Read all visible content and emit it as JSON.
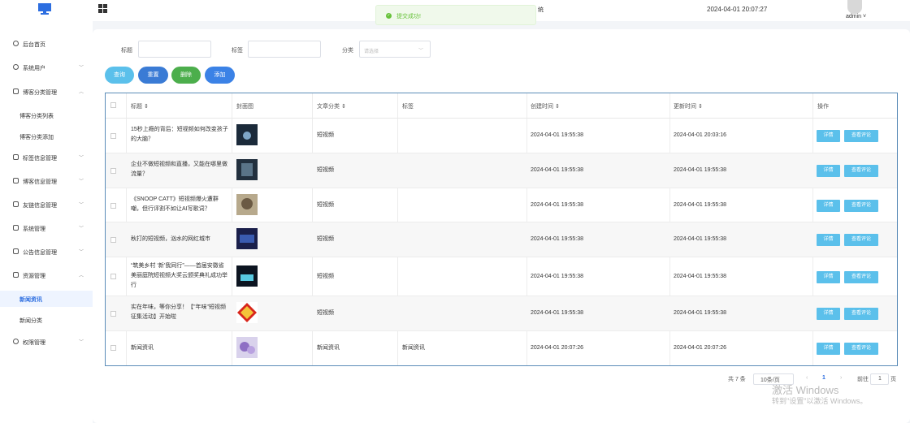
{
  "topbar": {
    "title_fragment": "统",
    "datetime": "2024-04-01 20:07:27",
    "user": "admin ˅"
  },
  "toast": {
    "message": "提交成功!"
  },
  "sidebar": {
    "items": [
      {
        "label": "后台首页",
        "icon": "dashboard-icon"
      },
      {
        "label": "系统用户",
        "icon": "user-icon"
      },
      {
        "label": "博客分类管理",
        "icon": "folder-icon"
      },
      {
        "label": "博客分类列表",
        "icon": ""
      },
      {
        "label": "博客分类添加",
        "icon": ""
      },
      {
        "label": "标签信息管理",
        "icon": "tag-icon"
      },
      {
        "label": "博客信息管理",
        "icon": "doc-icon"
      },
      {
        "label": "友链信息管理",
        "icon": "link-icon"
      },
      {
        "label": "系统管理",
        "icon": "settings-icon"
      },
      {
        "label": "公告信息管理",
        "icon": "notice-icon"
      },
      {
        "label": "资源管理",
        "icon": "resource-icon"
      },
      {
        "label": "新闻资讯",
        "icon": ""
      },
      {
        "label": "新闻分类",
        "icon": ""
      },
      {
        "label": "权限管理",
        "icon": "user-icon"
      }
    ]
  },
  "filters": {
    "title_label": "标题",
    "tag_label": "标签",
    "category_label": "分类",
    "category_placeholder": "请选择"
  },
  "buttons": {
    "search": "查询",
    "reset": "重置",
    "delete": "删除",
    "add": "添加"
  },
  "colors": {
    "search": "#5bc0eb",
    "reset": "#3a7bd5",
    "delete": "#4cae4c",
    "add": "#3b82e6",
    "action": "#5bc0eb"
  },
  "table": {
    "headers": [
      "标题 ⇕",
      "封面图",
      "文章分类 ⇕",
      "标签",
      "创建时间 ⇕",
      "更新时间 ⇕",
      "操作"
    ],
    "rows": [
      {
        "title": "15秒上瘾的背后：短视频如何改变孩子的大脑？",
        "category": "短视频",
        "tag": "",
        "created": "2024-04-01 19:55:38",
        "updated": "2024-04-01 20:03:16"
      },
      {
        "title": "企业不做短视频和直播，又能在哪里做流量？",
        "category": "短视频",
        "tag": "",
        "created": "2024-04-01 19:55:38",
        "updated": "2024-04-01 19:55:38"
      },
      {
        "title": "《SNOOP CATT》短视频爆火遭群嘲，但行评割不如让AI写歌词？",
        "category": "短视频",
        "tag": "",
        "created": "2024-04-01 19:55:38",
        "updated": "2024-04-01 19:55:38"
      },
      {
        "title": "秋打的短视频，汹水的网红城市",
        "category": "短视频",
        "tag": "",
        "created": "2024-04-01 19:55:38",
        "updated": "2024-04-01 19:55:38"
      },
      {
        "title": "“筑美乡村 ‘新’我同行”——首届安徽省美丽庭院短视频大奖云颁奖典礼成功举行",
        "category": "短视频",
        "tag": "",
        "created": "2024-04-01 19:55:38",
        "updated": "2024-04-01 19:55:38"
      },
      {
        "title": "实在年味，等你分享！【\"年味\"短视频 征集活动】开始啦",
        "category": "短视频",
        "tag": "",
        "created": "2024-04-01 19:55:38",
        "updated": "2024-04-01 19:55:38"
      },
      {
        "title": "新闻资讯",
        "category": "新闻资讯",
        "tag": "新闻资讯",
        "created": "2024-04-01 20:07:26",
        "updated": "2024-04-01 20:07:26"
      }
    ],
    "detail_label": "详情",
    "comment_label": "查看评论"
  },
  "pagination": {
    "total": "共 7 条",
    "page_size": "10条/页",
    "prev": "‹",
    "current": "1",
    "next": "›",
    "goto_label": "前往",
    "goto_value": "1",
    "page_suffix": "页"
  },
  "watermark": {
    "line1": "激活 Windows",
    "line2": "转到\"设置\"以激活 Windows。"
  }
}
